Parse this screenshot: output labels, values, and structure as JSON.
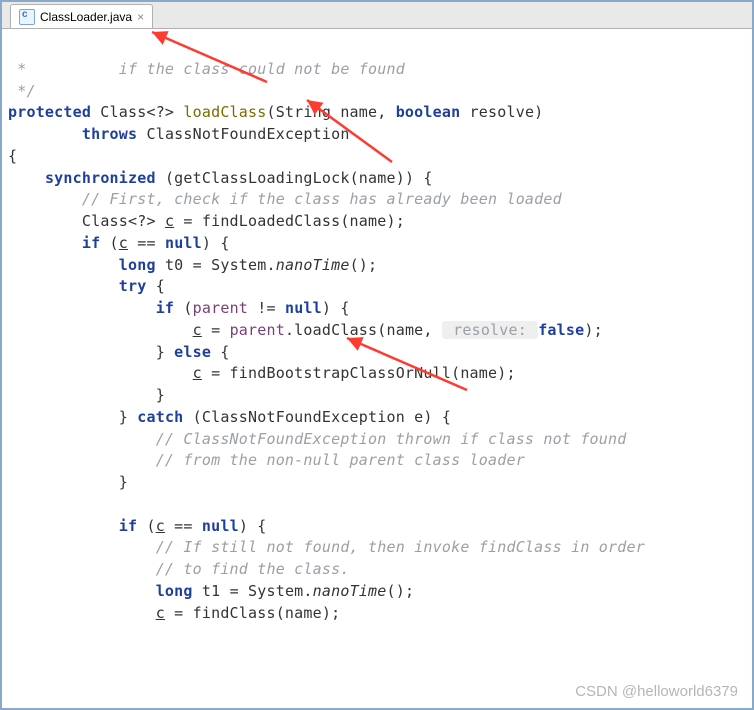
{
  "tab": {
    "filename": "ClassLoader.java",
    "close_glyph": "×"
  },
  "code": {
    "l1_a": " *          ",
    "l1_b": "if the class could not be found",
    "l2": " */",
    "l3_kw_protected": "protected",
    "l3_type": " Class<?> ",
    "l3_method": "loadClass",
    "l3_params_a": "(String name, ",
    "l3_kw_bool": "boolean",
    "l3_params_b": " resolve)",
    "l4_kw_throws": "throws",
    "l4_ex": " ClassNotFoundException",
    "l5": "{",
    "l6_kw_sync": "synchronized",
    "l6_rest": " (getClassLoadingLock(name)) {",
    "l7": "// First, check if the class has already been loaded",
    "l8_a": "Class<?> ",
    "l8_var": "c",
    "l8_b": " = findLoadedClass(name);",
    "l9_kw_if": "if",
    "l9_a": " (",
    "l9_var": "c",
    "l9_b": " == ",
    "l9_kw_null": "null",
    "l9_c": ") {",
    "l10_kw_long": "long",
    "l10_a": " t0 = System.",
    "l10_m": "nanoTime",
    "l10_b": "();",
    "l11_kw_try": "try",
    "l11_a": " {",
    "l12_kw_if": "if",
    "l12_a": " (",
    "l12_field": "parent",
    "l12_b": " != ",
    "l12_kw_null": "null",
    "l12_c": ") {",
    "l13_var": "c",
    "l13_a": " = ",
    "l13_field": "parent",
    "l13_b": ".loadClass(name, ",
    "l13_hint": " resolve: ",
    "l13_kw_false": "false",
    "l13_c": ");",
    "l14_a": "} ",
    "l14_kw_else": "else",
    "l14_b": " {",
    "l15_var": "c",
    "l15_a": " = findBootstrapClassOrNull(name);",
    "l16": "}",
    "l17_a": "} ",
    "l17_kw_catch": "catch",
    "l17_b": " (ClassNotFoundException e) {",
    "l18": "// ClassNotFoundException thrown if class not found",
    "l19": "// from the non-null parent class loader",
    "l20": "}",
    "l21_kw_if": "if",
    "l21_a": " (",
    "l21_var": "c",
    "l21_b": " == ",
    "l21_kw_null": "null",
    "l21_c": ") {",
    "l22": "// If still not found, then invoke findClass in order",
    "l23": "// to find the class.",
    "l24_kw_long": "long",
    "l24_a": " t1 = System.",
    "l24_m": "nanoTime",
    "l24_b": "();",
    "l25_var": "c",
    "l25_a": " = findClass(name);"
  },
  "annotation": {
    "arrow_color": "#ff3b30"
  },
  "watermark": "CSDN @helloworld6379"
}
